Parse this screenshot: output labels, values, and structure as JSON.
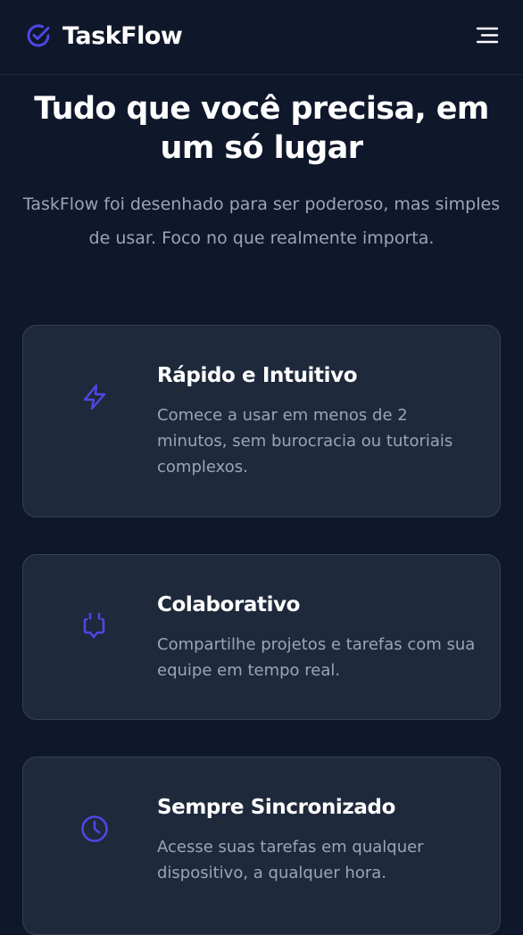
{
  "header": {
    "brand_name": "TaskFlow",
    "logo_icon": "check-circle-icon",
    "menu_icon": "menu-icon"
  },
  "hero": {
    "title": "Tudo que você precisa, em um só lugar",
    "subtitle": "TaskFlow foi desenhado para ser poderoso, mas simples de usar. Foco no que realmente importa."
  },
  "features": [
    {
      "icon": "lightning-icon",
      "title": "Rápido e Intuitivo",
      "description": "Comece a usar em menos de 2 minutos, sem burocracia ou tutoriais complexos."
    },
    {
      "icon": "chat-icon",
      "title": "Colaborativo",
      "description": "Compartilhe projetos e tarefas com sua equipe em tempo real."
    },
    {
      "icon": "clock-icon",
      "title": "Sempre Sincronizado",
      "description": "Acesse suas tarefas em qualquer dispositivo, a qualquer hora."
    }
  ],
  "colors": {
    "background": "#0f172a",
    "card": "#1e293b",
    "accent": "#4f46e5",
    "muted_text": "#9aa5b8"
  }
}
